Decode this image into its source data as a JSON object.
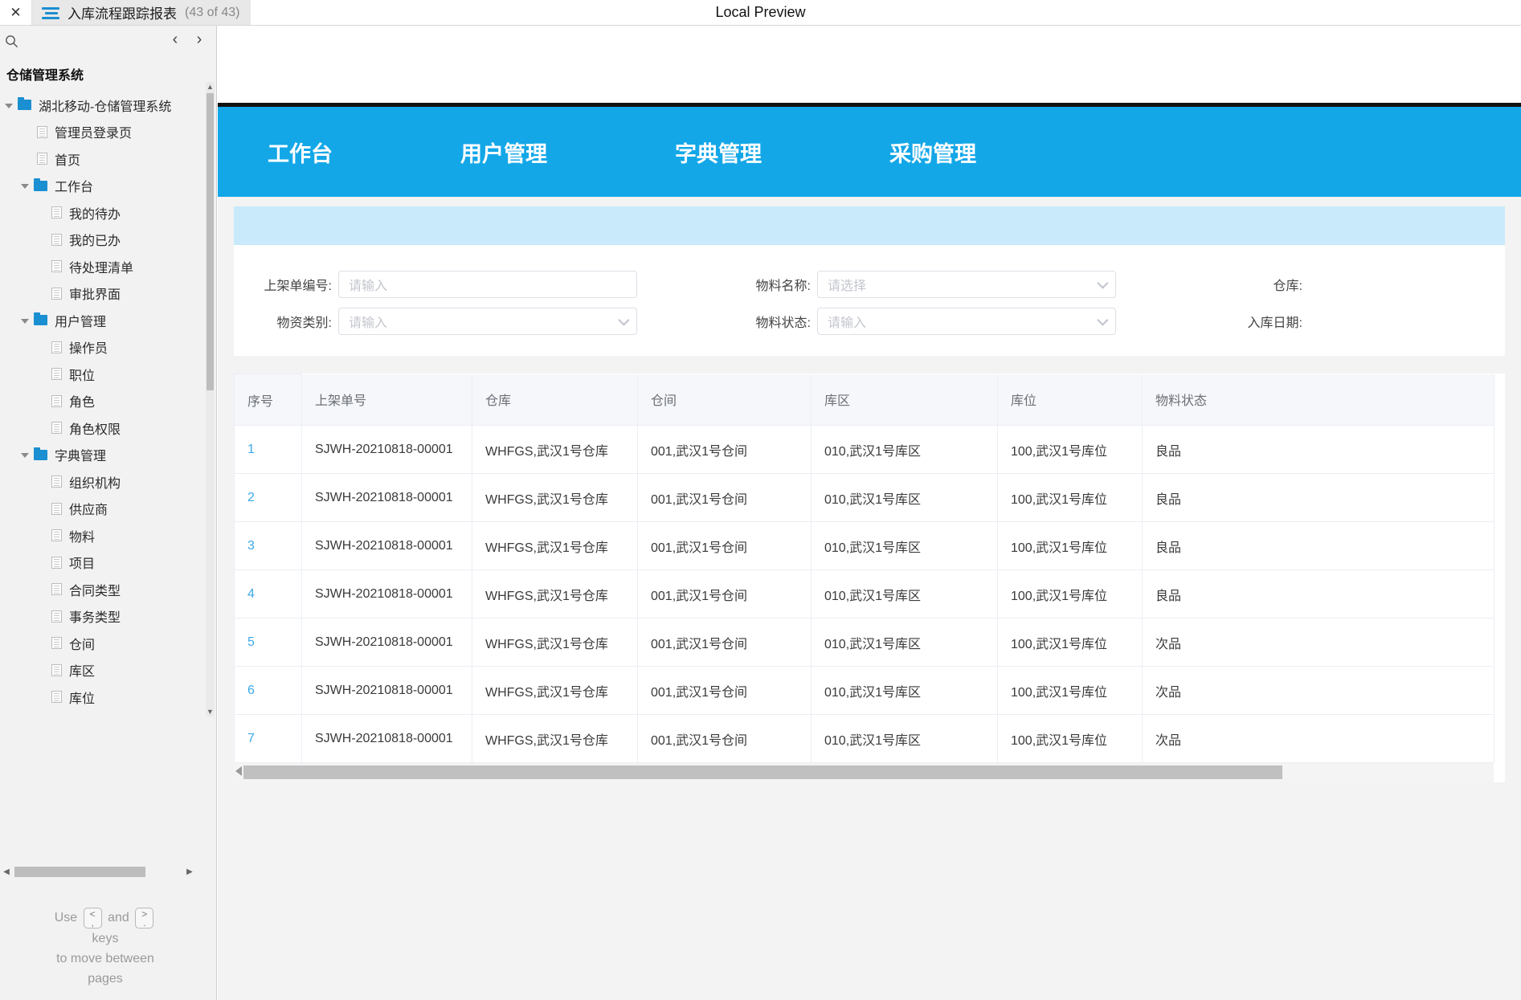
{
  "window": {
    "close_label": "✕",
    "menu_icon": "hamburger-icon",
    "tab_title": "入库流程跟踪报表",
    "tab_count": "(43 of 43)",
    "preview_label": "Local Preview"
  },
  "sidebar": {
    "search_icon": "search-icon",
    "prev_label": "‹",
    "next_label": "›",
    "heading": "仓储管理系统",
    "tree": [
      {
        "label": "湖北移动-仓储管理系统",
        "type": "folder",
        "level": 0,
        "expanded": true
      },
      {
        "label": "管理员登录页",
        "type": "doc",
        "level": 1
      },
      {
        "label": "首页",
        "type": "doc",
        "level": 1
      },
      {
        "label": "工作台",
        "type": "folder",
        "level": 2,
        "expanded": true
      },
      {
        "label": "我的待办",
        "type": "doc",
        "level": 3
      },
      {
        "label": "我的已办",
        "type": "doc",
        "level": 3
      },
      {
        "label": "待处理清单",
        "type": "doc",
        "level": 3
      },
      {
        "label": "审批界面",
        "type": "doc",
        "level": 3
      },
      {
        "label": "用户管理",
        "type": "folder",
        "level": 2,
        "expanded": true
      },
      {
        "label": "操作员",
        "type": "doc",
        "level": 3
      },
      {
        "label": "职位",
        "type": "doc",
        "level": 3
      },
      {
        "label": "角色",
        "type": "doc",
        "level": 3
      },
      {
        "label": "角色权限",
        "type": "doc",
        "level": 3
      },
      {
        "label": "字典管理",
        "type": "folder",
        "level": 2,
        "expanded": true
      },
      {
        "label": "组织机构",
        "type": "doc",
        "level": 3
      },
      {
        "label": "供应商",
        "type": "doc",
        "level": 3
      },
      {
        "label": "物料",
        "type": "doc",
        "level": 3
      },
      {
        "label": "项目",
        "type": "doc",
        "level": 3
      },
      {
        "label": "合同类型",
        "type": "doc",
        "level": 3
      },
      {
        "label": "事务类型",
        "type": "doc",
        "level": 3
      },
      {
        "label": "仓间",
        "type": "doc",
        "level": 3
      },
      {
        "label": "库区",
        "type": "doc",
        "level": 3
      },
      {
        "label": "库位",
        "type": "doc",
        "level": 3
      }
    ],
    "hint": {
      "use": "Use",
      "key_prev_top": "<",
      "key_prev_bottom": ",",
      "and": "and",
      "key_next_top": ">",
      "key_next_bottom": ".",
      "line2": "keys",
      "line3": "to move between",
      "line4": "pages"
    }
  },
  "app": {
    "accent_color": "#14a7e8",
    "banner_color": "#c8eafb",
    "nav": [
      {
        "label": "工作台"
      },
      {
        "label": "用户管理"
      },
      {
        "label": "字典管理"
      },
      {
        "label": "采购管理"
      }
    ],
    "filters": [
      {
        "label": "上架单编号:",
        "placeholder": "请输入",
        "kind": "text"
      },
      {
        "label": "物料名称:",
        "placeholder": "请选择",
        "kind": "select"
      },
      {
        "label": "仓库:",
        "placeholder": "",
        "kind": "label-only"
      },
      {
        "label": "物资类别:",
        "placeholder": "请输入",
        "kind": "select"
      },
      {
        "label": "物料状态:",
        "placeholder": "请输入",
        "kind": "select"
      },
      {
        "label": "入库日期:",
        "placeholder": "",
        "kind": "label-only"
      }
    ],
    "table": {
      "columns": [
        "序号",
        "上架单号",
        "仓库",
        "仓间",
        "库区",
        "库位",
        "物料状态"
      ],
      "rows": [
        [
          "1",
          "SJWH-20210818-00001",
          "WHFGS,武汉1号仓库",
          "001,武汉1号仓间",
          "010,武汉1号库区",
          "100,武汉1号库位",
          "良品"
        ],
        [
          "2",
          "SJWH-20210818-00001",
          "WHFGS,武汉1号仓库",
          "001,武汉1号仓间",
          "010,武汉1号库区",
          "100,武汉1号库位",
          "良品"
        ],
        [
          "3",
          "SJWH-20210818-00001",
          "WHFGS,武汉1号仓库",
          "001,武汉1号仓间",
          "010,武汉1号库区",
          "100,武汉1号库位",
          "良品"
        ],
        [
          "4",
          "SJWH-20210818-00001",
          "WHFGS,武汉1号仓库",
          "001,武汉1号仓间",
          "010,武汉1号库区",
          "100,武汉1号库位",
          "良品"
        ],
        [
          "5",
          "SJWH-20210818-00001",
          "WHFGS,武汉1号仓库",
          "001,武汉1号仓间",
          "010,武汉1号库区",
          "100,武汉1号库位",
          "次品"
        ],
        [
          "6",
          "SJWH-20210818-00001",
          "WHFGS,武汉1号仓库",
          "001,武汉1号仓间",
          "010,武汉1号库区",
          "100,武汉1号库位",
          "次品"
        ],
        [
          "7",
          "SJWH-20210818-00001",
          "WHFGS,武汉1号仓库",
          "001,武汉1号仓间",
          "010,武汉1号库区",
          "100,武汉1号库位",
          "次品"
        ]
      ]
    }
  }
}
